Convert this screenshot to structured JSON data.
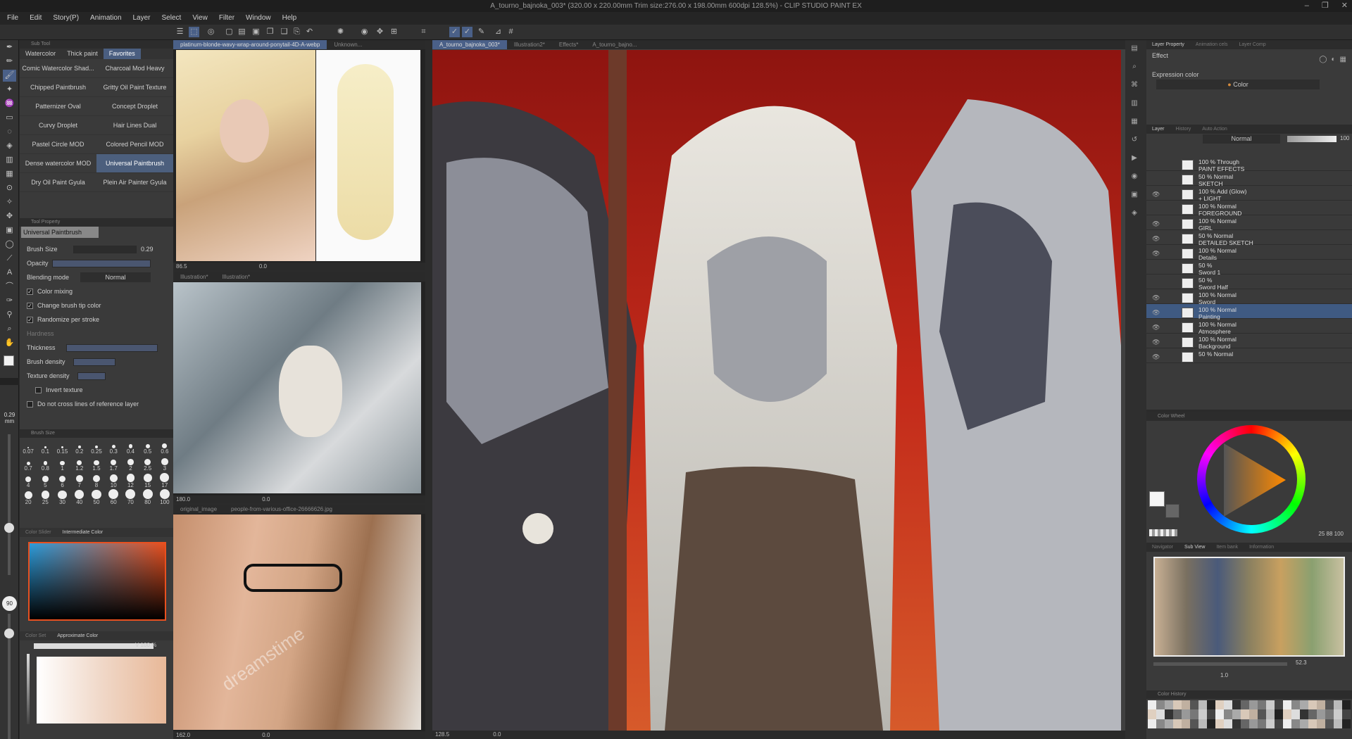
{
  "title": "A_tourno_bajnoka_003* (320.00 x 220.00mm Trim size:276.00 x 198.00mm 600dpi 128.5%) - CLIP STUDIO PAINT EX",
  "menu": [
    "File",
    "Edit",
    "Story(P)",
    "Animation",
    "Layer",
    "Select",
    "View",
    "Filter",
    "Window",
    "Help"
  ],
  "window_controls": [
    "–",
    "❐",
    "✕"
  ],
  "subtool": {
    "header": "Sub Tool",
    "tabs": [
      "Watercolor",
      "Thick paint",
      "Favorites"
    ],
    "brushes": [
      "Comic Watercolor Shad...",
      "Charcoal Mod Heavy",
      "Chipped Paintbrush",
      "Gritty Oil Paint Texture",
      "Patternizer Oval",
      "Concept Droplet",
      "Curvy Droplet",
      "Hair Lines Dual",
      "Pastel Circle MOD",
      "Colored Pencil MOD",
      "Dense watercolor MOD",
      "Universal Paintbrush",
      "Dry Oil Paint Gyula",
      "Plein Air Painter Gyula"
    ]
  },
  "tool_property": {
    "header": "Tool Property",
    "current": "Universal Paintbrush",
    "brush_size_label": "Brush Size",
    "brush_size_value": "0.29",
    "opacity_label": "Opacity",
    "blending_label": "Blending mode",
    "blending_value": "Normal",
    "color_mixing": "Color mixing",
    "change_tip": "Change brush tip color",
    "randomize": "Randomize per stroke",
    "hardness": "Hardness",
    "thickness": "Thickness",
    "brush_density": "Brush density",
    "texture_density": "Texture density",
    "invert_texture": "Invert texture",
    "no_cross": "Do not cross lines of reference layer"
  },
  "brush_size_panel": {
    "header": "Brush Size",
    "row1": [
      "0.07",
      "0.1",
      "0.15",
      "0.2",
      "0.25",
      "0.3",
      "0.4",
      "0.5",
      "0.6"
    ],
    "row2": [
      "0.7",
      "0.8",
      "1",
      "1.2",
      "1.5",
      "1.7",
      "2",
      "2.5",
      "3"
    ],
    "row3": [
      "4",
      "5",
      "6",
      "7",
      "8",
      "10",
      "12",
      "15",
      "17"
    ],
    "row4": [
      "20",
      "25",
      "30",
      "40",
      "50",
      "60",
      "70",
      "80",
      "100"
    ]
  },
  "color_panel": {
    "tabs": [
      "Color Slider",
      "Intermediate Color"
    ],
    "tabs2": [
      "Color Set",
      "Approximate Color"
    ],
    "value_readout": "V 100 %"
  },
  "left_strip": {
    "size_readout": "0.29",
    "size_unit": "mm",
    "zoom_badge": "90"
  },
  "reference": {
    "top_tabs": [
      "platinum-blonde-wavy-wrap-around-ponytail-4D-A-webp",
      "Unknown..."
    ],
    "top_status": [
      "86.5",
      "0.0"
    ],
    "mid_tabs": [
      "Illustration*",
      "Illustration*"
    ],
    "mid_status": [
      "180.0",
      "0.0"
    ],
    "bottom_tabs": [
      "original_image",
      "people-from-various-office-26666626.jpg"
    ],
    "bottom_status": [
      "162.0",
      "0.0"
    ],
    "watermark": "dreamstime"
  },
  "canvas": {
    "tabs": [
      "A_tourno_bajnoka_003*",
      "Illustration2*",
      "Effects*",
      "A_tourno_bajno..."
    ],
    "status_zoom": "128.5",
    "status_angle": "0.0"
  },
  "layer_property": {
    "tabs": [
      "Layer Property",
      "Animation cels",
      "Layer Comp"
    ],
    "effect_label": "Effect",
    "expression_label": "Expression color",
    "expression_value": "Color"
  },
  "layer_panel": {
    "tabs": [
      "Layer",
      "History",
      "Auto Action"
    ],
    "blend_mode": "Normal",
    "opacity": "100",
    "layers": [
      {
        "l1": "100 % Through",
        "l2": "PAINT EFFECTS",
        "eye": "",
        "sel": false
      },
      {
        "l1": "50 % Normal",
        "l2": "SKETCH",
        "eye": "",
        "sel": false
      },
      {
        "l1": "100 % Add (Glow)",
        "l2": "+ LIGHT",
        "eye": "👁",
        "sel": false
      },
      {
        "l1": "100 % Normal",
        "l2": "FOREGROUND",
        "eye": "",
        "sel": false
      },
      {
        "l1": "100 % Normal",
        "l2": "GIRL",
        "eye": "👁",
        "sel": false
      },
      {
        "l1": "50 % Normal",
        "l2": "DETAILED SKETCH",
        "eye": "👁",
        "sel": false
      },
      {
        "l1": "100 % Normal",
        "l2": "Details",
        "eye": "👁",
        "sel": false
      },
      {
        "l1": "50 %",
        "l2": "Sword 1",
        "eye": "",
        "sel": false
      },
      {
        "l1": "50 %",
        "l2": "Sword Half",
        "eye": "",
        "sel": false
      },
      {
        "l1": "100 % Normal",
        "l2": "Sword",
        "eye": "👁",
        "sel": false
      },
      {
        "l1": "100 % Normal",
        "l2": "Painting",
        "eye": "👁",
        "sel": true
      },
      {
        "l1": "100 % Normal",
        "l2": "Atmosphere",
        "eye": "👁",
        "sel": false
      },
      {
        "l1": "100 % Normal",
        "l2": "Background",
        "eye": "👁",
        "sel": false
      },
      {
        "l1": "50 % Normal",
        "l2": "",
        "eye": "👁",
        "sel": false
      }
    ]
  },
  "color_wheel": {
    "header": "Color Wheel",
    "readout": "25 88 100"
  },
  "sub_view": {
    "tabs": [
      "Navigator",
      "Sub View",
      "Item bank",
      "Information"
    ],
    "zoom": "52.3",
    "rotate": "1.0"
  },
  "color_history": {
    "header": "Color History"
  },
  "colors": {
    "accent": "#4a6088",
    "panel": "#3a3a3a",
    "selected_layer": "#3f5a82",
    "canvas_bg_red": "#b01e18"
  }
}
